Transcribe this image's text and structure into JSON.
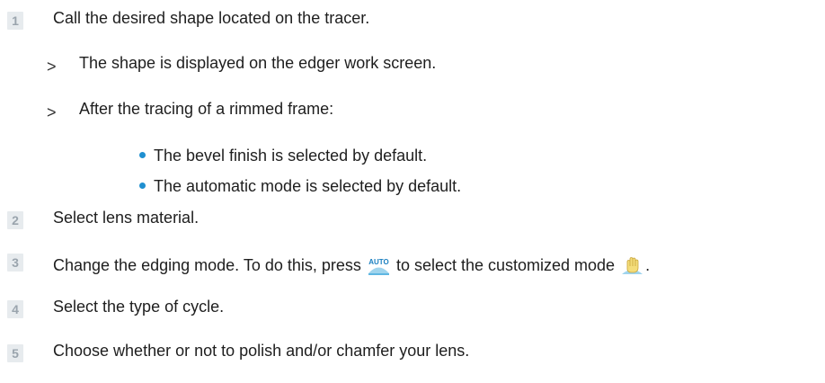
{
  "steps": [
    {
      "number": "1",
      "text": "Call the desired shape located on the tracer."
    },
    {
      "number": "2",
      "text": "Select lens material."
    },
    {
      "number": "3",
      "text_before": "Change the edging mode. To do this, press",
      "text_middle": "to select the customized mode",
      "text_after": "."
    },
    {
      "number": "4",
      "text": "Select the type of cycle."
    },
    {
      "number": "5",
      "text": "Choose whether or not to polish and/or chamfer your lens."
    }
  ],
  "results": [
    {
      "marker": ">",
      "text": "The shape is displayed on the edger work screen."
    },
    {
      "marker": ">",
      "text": "After the tracing of a rimmed frame:"
    }
  ],
  "bullets": [
    "The bevel finish is selected by default.",
    "The automatic mode is selected by default."
  ],
  "icons": {
    "auto_button": {
      "name": "auto-mode-icon",
      "label": "AUTO",
      "color": "#2a9fd8"
    },
    "custom_mode": {
      "name": "hand-icon",
      "color": "#e8c84a"
    }
  },
  "colors": {
    "bullet": "#1f8fd0",
    "step_number": "#9aa4ad",
    "step_background": "#e7ebee"
  }
}
